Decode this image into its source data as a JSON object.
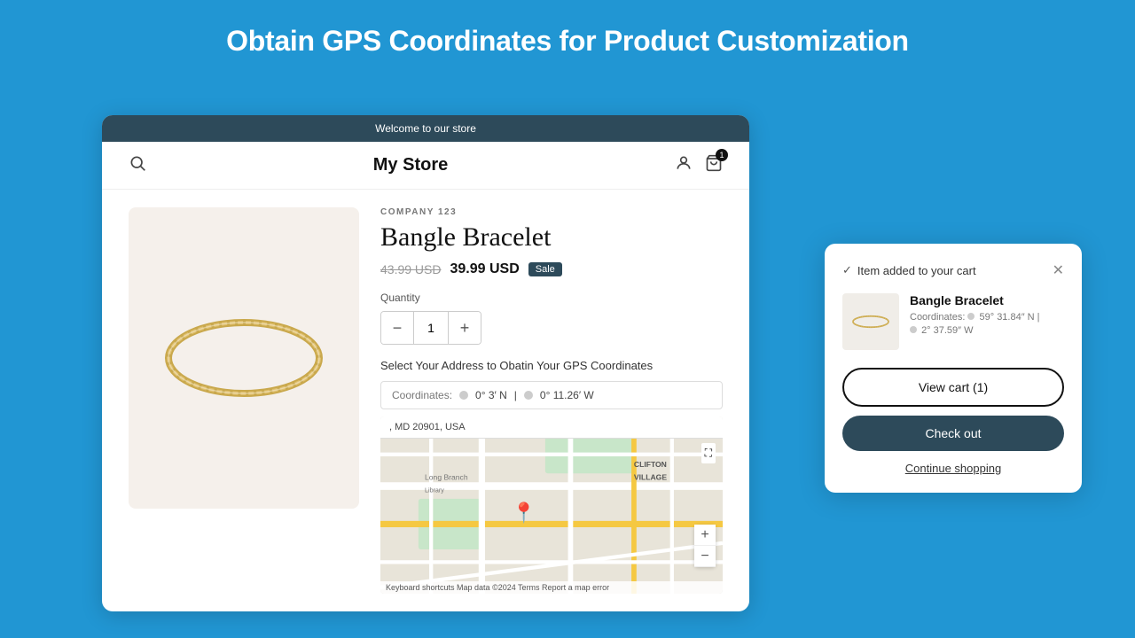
{
  "page": {
    "title": "Obtain GPS Coordinates for Product Customization",
    "background_color": "#2196d3"
  },
  "store": {
    "topbar_text": "Welcome to our store",
    "logo": "My Store",
    "company": "COMPANY 123",
    "product_title": "Bangle Bracelet",
    "price_original": "43.99 USD",
    "price_sale": "39.99 USD",
    "sale_badge": "Sale",
    "quantity_label": "Quantity",
    "quantity_value": "1",
    "address_label": "Select Your Address to Obatin Your GPS Coordinates",
    "coordinates_label": "Coordinates:",
    "coordinates_lat": "0° 3′ N",
    "coordinates_lng": "0° 11.26′ W",
    "map_address": ", MD 20901, USA",
    "map_footer": "Keyboard shortcuts  Map data ©2024  Terms  Report a map error"
  },
  "cart_popup": {
    "added_text": "Item added to your cart",
    "item_name": "Bangle Bracelet",
    "item_coords_label": "Coordinates:",
    "item_coords_lat": "59° 31.84″ N |",
    "item_coords_lng": "2° 37.59″ W",
    "view_cart_label": "View cart (1)",
    "checkout_label": "Check out",
    "continue_label": "Continue shopping"
  }
}
